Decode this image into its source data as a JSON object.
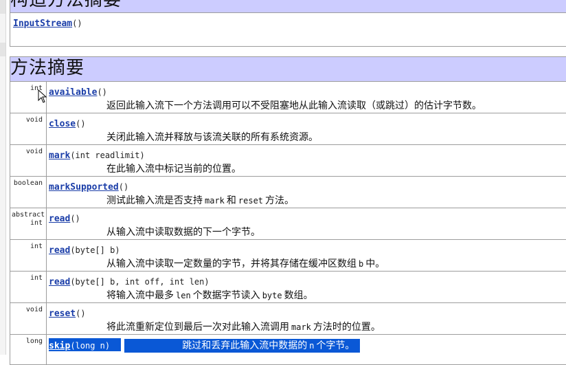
{
  "constructor_summary": {
    "title": "构造方法摘要",
    "ctor_name": "InputStream",
    "ctor_params": "()"
  },
  "method_summary": {
    "title": "方法摘要",
    "rows": [
      {
        "modifier": "int",
        "name": "available",
        "params": "()",
        "desc": "返回此输入流下一个方法调用可以不受阻塞地从此输入流读取（或跳过）的估计字节数。"
      },
      {
        "modifier": "void",
        "name": "close",
        "params": "()",
        "desc": "关闭此输入流并释放与该流关联的所有系统资源。"
      },
      {
        "modifier": "void",
        "name": "mark",
        "params": "(int readlimit)",
        "desc": "在此输入流中标记当前的位置。"
      },
      {
        "modifier": "boolean",
        "name": "markSupported",
        "params": "()",
        "desc_a": "测试此输入流是否支持",
        "desc_code1": "mark",
        "desc_b": "和",
        "desc_code2": "reset",
        "desc_c": "方法。"
      },
      {
        "modifier_line1": "abstract",
        "modifier_line2": "int",
        "name": "read",
        "params": "()",
        "desc": "从输入流中读取数据的下一个字节。"
      },
      {
        "modifier": "int",
        "name": "read",
        "params": "(byte[] b)",
        "desc_a": "从输入流中读取一定数量的字节，并将其存储在缓冲区数组",
        "desc_code": "b",
        "desc_b": "中。"
      },
      {
        "modifier": "int",
        "name": "read",
        "params": "(byte[] b, int off, int len)",
        "desc_a": "将输入流中最多",
        "desc_code1": "len",
        "desc_b": "个数据字节读入",
        "desc_code2": "byte",
        "desc_c": "数组。"
      },
      {
        "modifier": "void",
        "name": "reset",
        "params": "()",
        "desc_a": "将此流重新定位到最后一次对此输入流调用",
        "desc_code": "mark",
        "desc_b": "方法时的位置。"
      },
      {
        "modifier": "long",
        "name": "skip",
        "params": "(long n)",
        "desc_a": "跳过和丢弃此输入流中数据的",
        "desc_code": "n",
        "desc_b": "个字节。"
      }
    ]
  },
  "colors": {
    "header_bg": "#ccccff",
    "link": "#1a3da8",
    "selection": "#0a58d6"
  }
}
